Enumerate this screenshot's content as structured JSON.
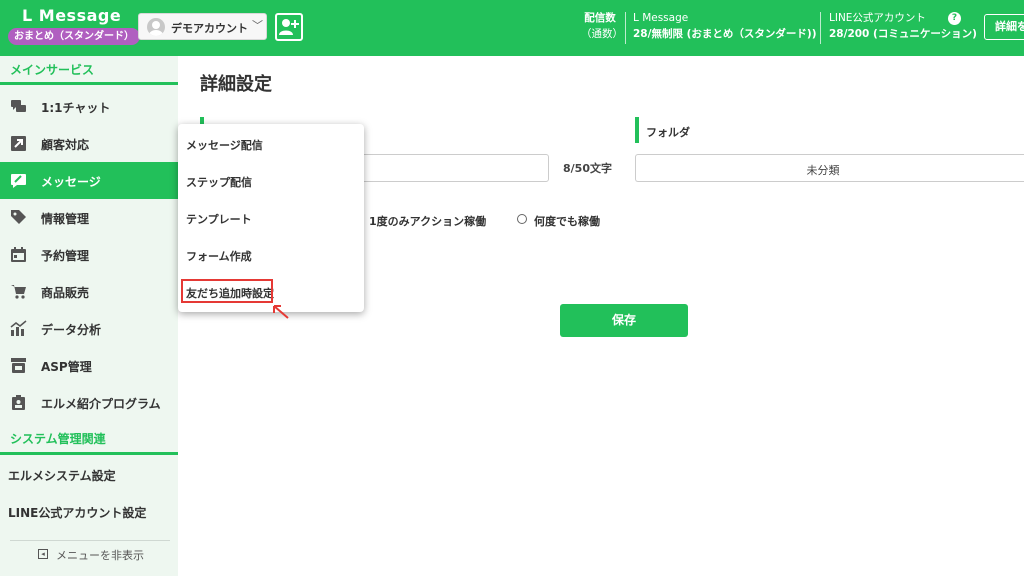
{
  "header": {
    "brand": "L Message",
    "plan_badge": "おまとめ（スタンダード）",
    "account_name": "デモアカウント",
    "stat_delivery_label": "配信数",
    "stat_delivery_sub": "（通数）",
    "stat_lmessage_label": "L Message",
    "stat_lmessage_value": "28/無制限 (おまとめ（スタンダード))",
    "stat_line_label": "LINE公式アカウント",
    "stat_line_value": "28/200 (コミュニケーション)",
    "detail_button": "詳細を"
  },
  "sidebar": {
    "main_section": "メインサービス",
    "items": [
      {
        "label": "1:1チャット",
        "icon": "chat-icon"
      },
      {
        "label": "顧客対応",
        "icon": "arrow-box-icon"
      },
      {
        "label": "メッセージ",
        "icon": "message-edit-icon",
        "active": true
      },
      {
        "label": "情報管理",
        "icon": "tag-icon"
      },
      {
        "label": "予約管理",
        "icon": "calendar-icon"
      },
      {
        "label": "商品販売",
        "icon": "cart-icon"
      },
      {
        "label": "データ分析",
        "icon": "chart-icon"
      },
      {
        "label": "ASP管理",
        "icon": "store-icon"
      },
      {
        "label": "エルメ紹介プログラム",
        "icon": "clipboard-icon"
      }
    ],
    "system_section": "システム管理関連",
    "settings": [
      {
        "label": "エルメシステム設定"
      },
      {
        "label": "LINE公式アカウント設定"
      }
    ],
    "hide_menu": "メニューを非表示"
  },
  "main": {
    "title": "詳細設定",
    "char_count": "8/50文字",
    "folder_label": "フォルダ",
    "folder_value": "未分類",
    "radio_once": "1度のみアクション稼働",
    "radio_any": "何度でも稼働",
    "save": "保存"
  },
  "dropdown": {
    "items": [
      "メッセージ配信",
      "ステップ配信",
      "テンプレート",
      "フォーム作成",
      "友だち追加時設定"
    ],
    "highlighted_index": 4
  },
  "colors": {
    "brand_green": "#22c05a",
    "badge_purple": "#b05fc0",
    "highlight_red": "#e53935"
  }
}
